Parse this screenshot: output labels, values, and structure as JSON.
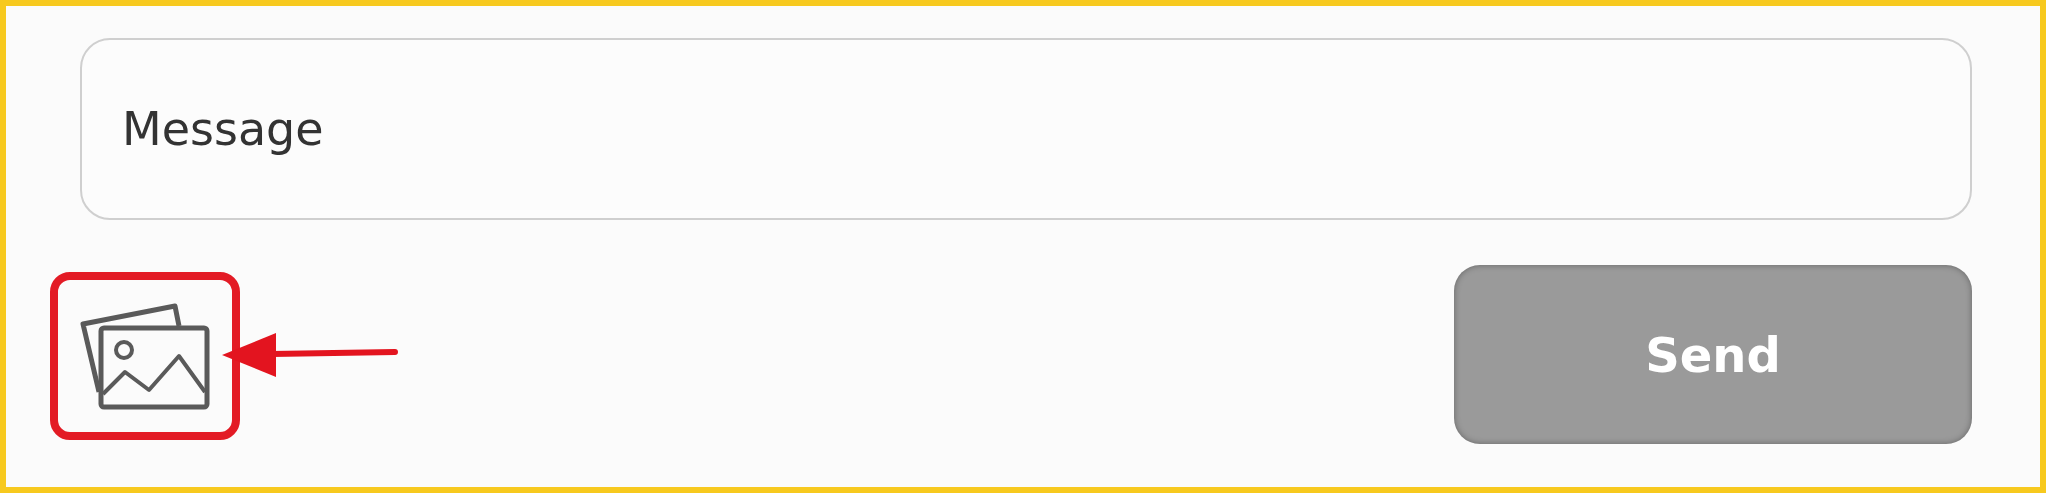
{
  "message_field": {
    "placeholder": "Message"
  },
  "send_button": {
    "label": "Send",
    "disabled": true
  }
}
